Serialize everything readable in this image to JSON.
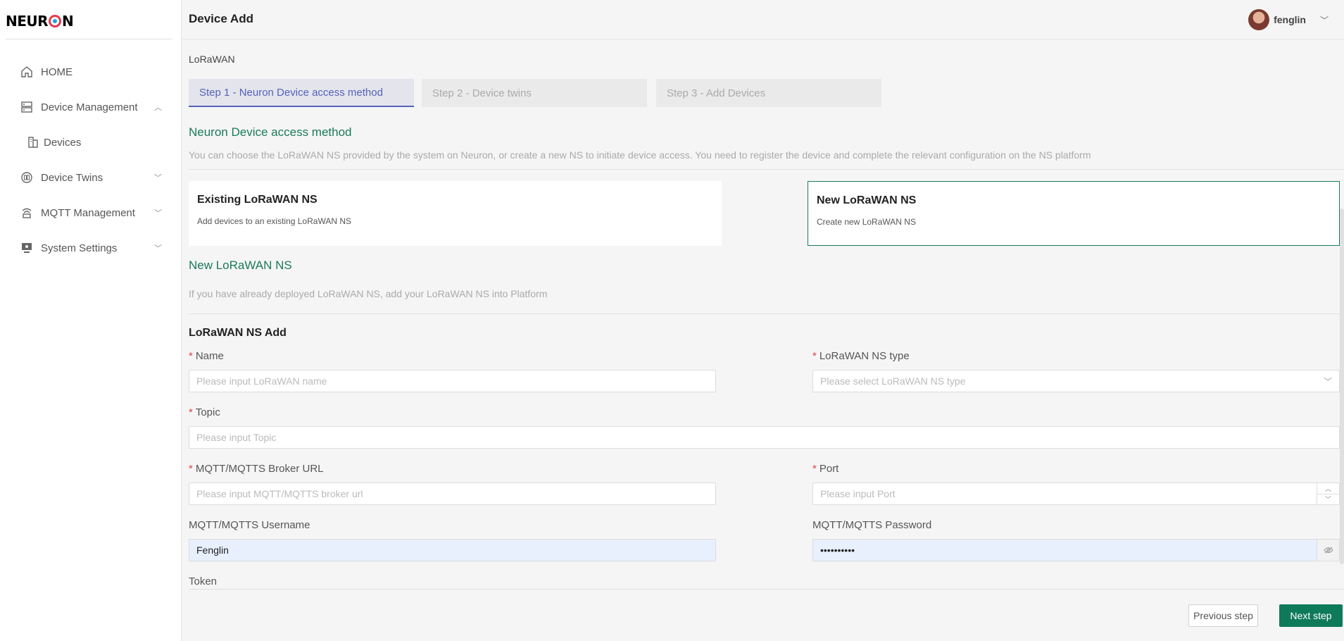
{
  "brand": {
    "logo_text_left": "NEUR",
    "logo_text_right": "N"
  },
  "sidebar": {
    "items": [
      {
        "label": "HOME",
        "icon": "home-icon",
        "chevron": ""
      },
      {
        "label": "Device Management",
        "icon": "server-icon",
        "chevron": "up"
      },
      {
        "label": "Devices",
        "icon": "devices-icon",
        "chevron": ""
      },
      {
        "label": "Device Twins",
        "icon": "twins-icon",
        "chevron": "down"
      },
      {
        "label": "MQTT Management",
        "icon": "mqtt-icon",
        "chevron": "down"
      },
      {
        "label": "System Settings",
        "icon": "monitor-icon",
        "chevron": "down"
      }
    ]
  },
  "header": {
    "title": "Device Add",
    "user_name": "fenglin"
  },
  "main": {
    "breadcrumb": "LoRaWAN",
    "steps": [
      {
        "label": "Step 1 - Neuron Device access method",
        "active": true
      },
      {
        "label": "Step 2 - Device twins",
        "active": false
      },
      {
        "label": "Step 3 - Add Devices",
        "active": false
      }
    ],
    "access": {
      "title": "Neuron Device access method",
      "description": "You can choose the LoRaWAN NS provided by the system on Neuron, or create a new NS to initiate device access. You need to register the device and complete the relevant configuration on the NS platform"
    },
    "options": [
      {
        "title": "Existing LoRaWAN NS",
        "description": "Add devices to an existing LoRaWAN NS",
        "selected": false
      },
      {
        "title": "New LoRaWAN NS",
        "description": "Create new LoRaWAN NS",
        "selected": true
      }
    ],
    "new_ns": {
      "title": "New LoRaWAN NS",
      "description": "If you have already deployed LoRaWAN NS, add your LoRaWAN NS into Platform"
    },
    "form": {
      "title": "LoRaWAN NS Add",
      "name_label": "Name",
      "name_placeholder": "Please input LoRaWAN name",
      "type_label": "LoRaWAN NS type",
      "type_placeholder": "Please select LoRaWAN NS type",
      "topic_label": "Topic",
      "topic_placeholder": "Please input Topic",
      "broker_label": "MQTT/MQTTS Broker URL",
      "broker_placeholder": "Please input MQTT/MQTTS broker url",
      "port_label": "Port",
      "port_placeholder": "Please input Port",
      "username_label": "MQTT/MQTTS Username",
      "username_value": "Fenglin",
      "password_label": "MQTT/MQTTS Password",
      "password_value": "••••••••••",
      "token_label": "Token",
      "required_mark": "*"
    },
    "buttons": {
      "previous": "Previous step",
      "next": "Next step"
    }
  },
  "colors": {
    "accent_green": "#1a7a5a",
    "step_active": "#5563b9",
    "required": "#e04040"
  }
}
